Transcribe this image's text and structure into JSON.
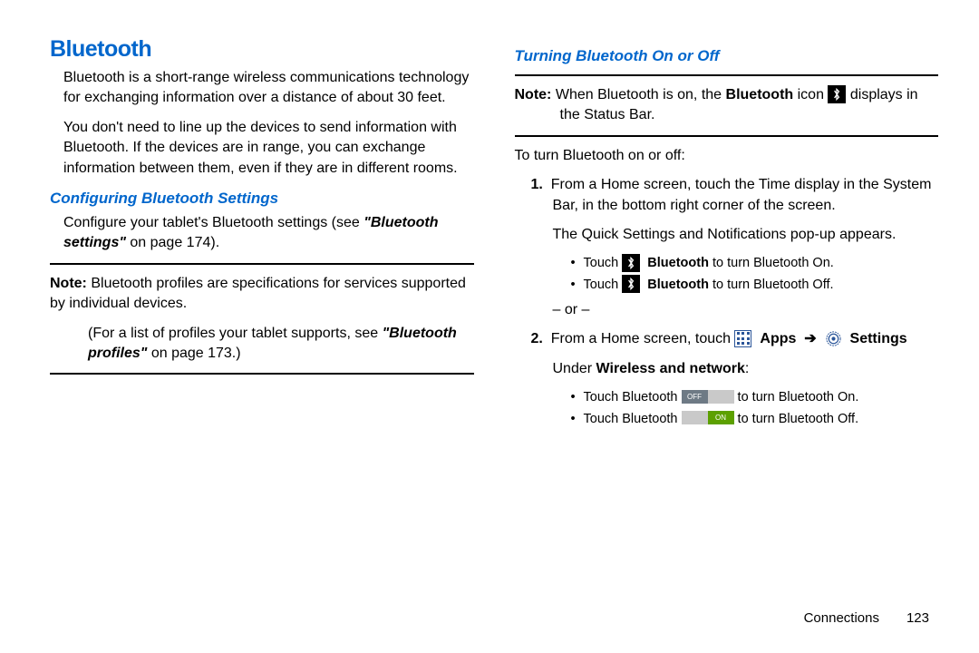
{
  "left": {
    "title": "Bluetooth",
    "intro1": "Bluetooth is a short-range wireless communications technology for exchanging information over a distance of about 30 feet.",
    "intro2": "You don't need to line up the devices to send information with Bluetooth. If the devices are in range, you can exchange information between them, even if they are in different rooms.",
    "sub1": "Configuring Bluetooth Settings",
    "configure_pre": "Configure your tablet's Bluetooth settings (see ",
    "configure_ref": "\"Bluetooth settings\"",
    "configure_post": " on page 174).",
    "note_label": "Note:",
    "note1_text": " Bluetooth profiles are specifications for services supported by individual devices.",
    "note2_pre": "(For a list of profiles your tablet supports, see ",
    "note2_ref": "\"Bluetooth profiles\"",
    "note2_post": " on page 173.)"
  },
  "right": {
    "sub": "Turning Bluetooth On or Off",
    "note_label": "Note:",
    "note_pre": " When Bluetooth is on, the ",
    "note_bold": "Bluetooth",
    "note_mid": " icon ",
    "note_post": " displays in the Status Bar.",
    "lead": "To turn Bluetooth on or off:",
    "step1a": "From a Home screen, touch the Time display in the System Bar, in the bottom right corner of the screen.",
    "step1b": "The Quick Settings and Notifications pop-up appears.",
    "b1_pre": "Touch ",
    "b1_bold": "Bluetooth",
    "b1_post": " to turn Bluetooth On.",
    "b2_pre": "Touch ",
    "b2_bold": "Bluetooth",
    "b2_post": " to turn Bluetooth Off.",
    "or": "– or –",
    "step2_pre": "From a Home screen, touch ",
    "apps": "Apps",
    "arrow": "➔",
    "settings": "Settings",
    "step2_line2_pre": "Under ",
    "step2_line2_bold": "Wireless and network",
    "step2_line2_post": ":",
    "t_pre": "Touch Bluetooth ",
    "t_off": "OFF",
    "t_on": "ON",
    "t1_post": " to turn Bluetooth On.",
    "t2_post": " to turn Bluetooth Off."
  },
  "footer": {
    "section": "Connections",
    "page": "123"
  }
}
